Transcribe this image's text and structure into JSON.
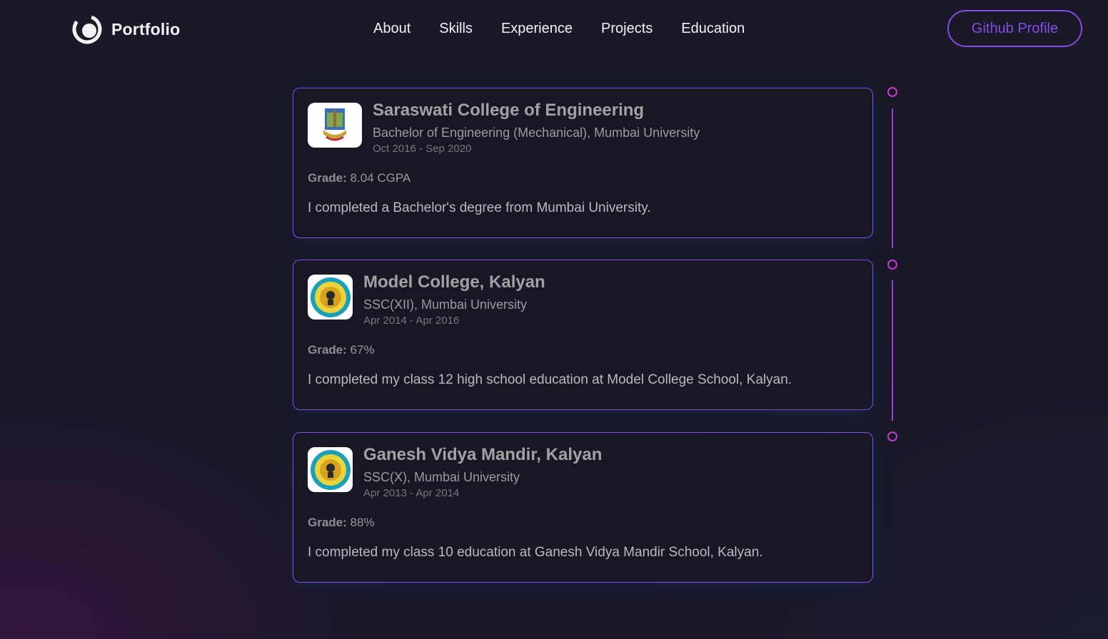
{
  "navbar": {
    "logo_text": "Portfolio",
    "links": [
      "About",
      "Skills",
      "Experience",
      "Projects",
      "Education"
    ],
    "github_button": "Github Profile"
  },
  "education": [
    {
      "school": "Saraswati College of Engineering",
      "degree": "Bachelor of Engineering (Mechanical), Mumbai University",
      "dates": "Oct 2016 - Sep 2020",
      "grade_label": "Grade:",
      "grade": "8.04 CGPA",
      "description": "I completed a Bachelor's degree from Mumbai University."
    },
    {
      "school": "Model College, Kalyan",
      "degree": "SSC(XII), Mumbai University",
      "dates": "Apr 2014 - Apr 2016",
      "grade_label": "Grade:",
      "grade": "67%",
      "description": "I completed my class 12 high school education at Model College School, Kalyan."
    },
    {
      "school": "Ganesh Vidya Mandir, Kalyan",
      "degree": "SSC(X), Mumbai University",
      "dates": "Apr 2013 - Apr 2014",
      "grade_label": "Grade:",
      "grade": "88%",
      "description": "I completed my class 10 education at Ganesh Vidya Mandir School, Kalyan."
    }
  ],
  "colors": {
    "accent": "#854ce6",
    "timeline": "#c23bd0",
    "background": "#181826"
  }
}
